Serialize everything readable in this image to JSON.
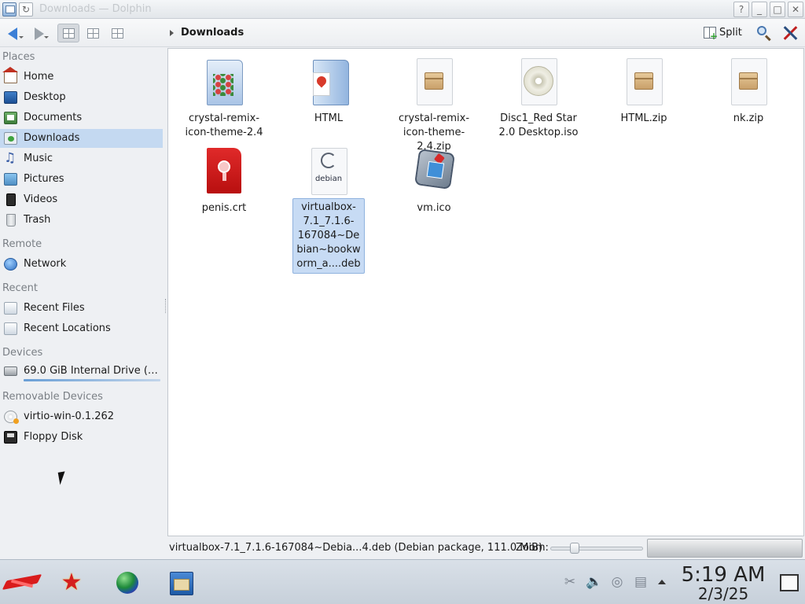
{
  "window": {
    "title": "Downloads — Dolphin"
  },
  "titlebar": {
    "help": "?",
    "minimize": "_",
    "maximize": "□",
    "close": "✕",
    "sticky": "↻"
  },
  "toolbar": {
    "breadcrumb": "Downloads",
    "split_label": "Split"
  },
  "sidebar": {
    "places_title": "Places",
    "places": [
      {
        "label": "Home",
        "icon": "home-icon"
      },
      {
        "label": "Desktop",
        "icon": "desktop-icon"
      },
      {
        "label": "Documents",
        "icon": "documents-icon"
      },
      {
        "label": "Downloads",
        "icon": "downloads-icon",
        "selected": true
      },
      {
        "label": "Music",
        "icon": "music-icon"
      },
      {
        "label": "Pictures",
        "icon": "pictures-icon"
      },
      {
        "label": "Videos",
        "icon": "videos-icon"
      },
      {
        "label": "Trash",
        "icon": "trash-icon"
      }
    ],
    "remote_title": "Remote",
    "remote": [
      {
        "label": "Network",
        "icon": "network-icon"
      }
    ],
    "recent_title": "Recent",
    "recent": [
      {
        "label": "Recent Files",
        "icon": "recent-files-icon"
      },
      {
        "label": "Recent Locations",
        "icon": "recent-locations-icon"
      }
    ],
    "devices_title": "Devices",
    "devices": [
      {
        "label": "69.0 GiB Internal Drive (sd...",
        "icon": "hard-drive-icon"
      }
    ],
    "removable_title": "Removable Devices",
    "removable": [
      {
        "label": "virtio-win-0.1.262",
        "icon": "optical-disc-icon"
      },
      {
        "label": "Floppy Disk",
        "icon": "floppy-disk-icon"
      }
    ]
  },
  "files": [
    {
      "name": "crystal-remix-icon-theme-2.4",
      "type": "folder",
      "icon": "folder-icon"
    },
    {
      "name": "HTML",
      "type": "folder",
      "icon": "folder-icon"
    },
    {
      "name": "crystal-remix-icon-theme-2.4.zip",
      "type": "zip",
      "icon": "archive-icon"
    },
    {
      "name": "Disc1_Red Star 2.0 Desktop.iso",
      "type": "iso",
      "icon": "disc-image-icon"
    },
    {
      "name": "HTML.zip",
      "type": "zip",
      "icon": "archive-icon"
    },
    {
      "name": "nk.zip",
      "type": "zip",
      "icon": "archive-icon"
    },
    {
      "name": "penis.crt",
      "type": "certificate",
      "icon": "certificate-icon"
    },
    {
      "name": "virtualbox-7.1_7.1.6-167084~Debian~bookworm_a....deb",
      "type": "deb",
      "icon": "debian-package-icon",
      "selected": true,
      "icon_text": "debian"
    },
    {
      "name": "vm.ico",
      "type": "ico",
      "icon": "virtualbox-icon"
    }
  ],
  "statusbar": {
    "text": "virtualbox-7.1_7.1.6-167084~Debia...4.deb (Debian package, 111.0 MiB)",
    "zoom_label": "Zoom:"
  },
  "taskbar": {
    "apps": [
      "start-menu-icon",
      "red-star-icon",
      "browser-globe-icon",
      "file-manager-icon"
    ],
    "tray": [
      "clipboard-scissors-icon",
      "volume-icon",
      "network-tray-icon",
      "display-icon"
    ],
    "time": "5:19 AM",
    "date": "2/3/25"
  },
  "colors": {
    "selection": "#c4d9f1",
    "accent": "#3c7fd6"
  }
}
